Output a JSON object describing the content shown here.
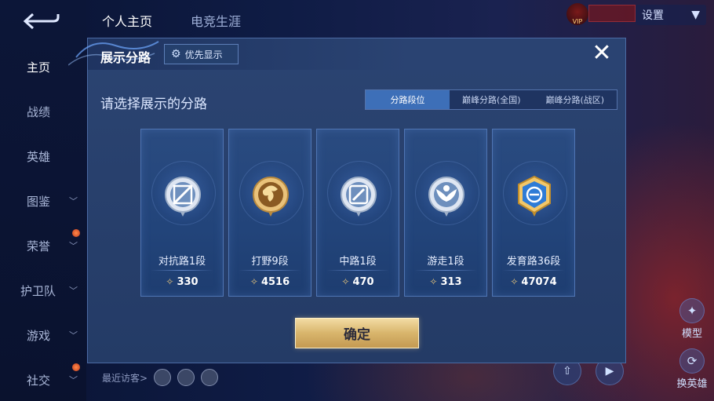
{
  "sidebar": {
    "items": [
      {
        "label": "主页",
        "active": true,
        "chevron": false,
        "dot": false
      },
      {
        "label": "战绩",
        "active": false,
        "chevron": false,
        "dot": false
      },
      {
        "label": "英雄",
        "active": false,
        "chevron": false,
        "dot": false
      },
      {
        "label": "图鉴",
        "active": false,
        "chevron": true,
        "dot": false
      },
      {
        "label": "荣誉",
        "active": false,
        "chevron": true,
        "dot": true
      },
      {
        "label": "护卫队",
        "active": false,
        "chevron": true,
        "dot": false
      },
      {
        "label": "游戏",
        "active": false,
        "chevron": true,
        "dot": false
      },
      {
        "label": "社交",
        "active": false,
        "chevron": true,
        "dot": true
      }
    ]
  },
  "top_tabs": [
    {
      "label": "个人主页",
      "active": true
    },
    {
      "label": "电竞生涯",
      "active": false
    }
  ],
  "settings_label": "设置",
  "vip_label": "VIP",
  "right_buttons": {
    "model": "模型",
    "change_hero": "换英雄"
  },
  "visitors_label": "最近访客>",
  "modal": {
    "title": "展示分路",
    "priority_label": "优先显示",
    "close_symbol": "✕",
    "subtitle": "请选择展示的分路",
    "segments": [
      {
        "label": "分路段位",
        "selected": true
      },
      {
        "label": "巅峰分路(全国)",
        "selected": false
      },
      {
        "label": "巅峰分路(战区)",
        "selected": false
      }
    ],
    "cards": [
      {
        "name": "对抗路1段",
        "score": "330",
        "icon": "clash-lane-badge-icon"
      },
      {
        "name": "打野9段",
        "score": "4516",
        "icon": "jungle-dragon-badge-icon"
      },
      {
        "name": "中路1段",
        "score": "470",
        "icon": "mid-lane-badge-icon"
      },
      {
        "name": "游走1段",
        "score": "313",
        "icon": "roam-wings-badge-icon"
      },
      {
        "name": "发育路36段",
        "score": "47074",
        "icon": "farm-lane-badge-icon"
      }
    ],
    "confirm_label": "确定"
  },
  "colors": {
    "accent_blue": "#3d6fb8",
    "gold_button": "#d8b56c",
    "modal_bg": "#243b66"
  }
}
